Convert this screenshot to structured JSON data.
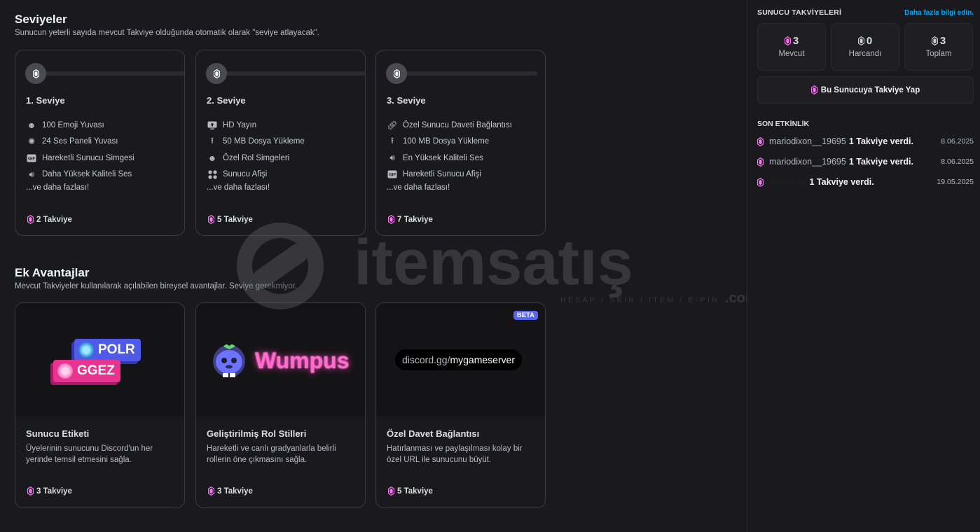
{
  "levels": {
    "title": "Seviyeler",
    "subtitle": "Sunucun yeterli sayıda mevcut Takviye olduğunda otomatik olarak \"seviye atlayacak\".",
    "tiers": [
      {
        "name": "1. Seviye",
        "perks": [
          {
            "icon": "emoji-icon",
            "label": "100 Emoji Yuvası"
          },
          {
            "icon": "soundboard-icon",
            "label": "24 Ses Paneli Yuvası"
          },
          {
            "icon": "gif-icon",
            "label": "Hareketli Sunucu Simgesi"
          },
          {
            "icon": "speaker-icon",
            "label": "Daha Yüksek Kaliteli Ses"
          }
        ],
        "more": "...ve daha fazlası!",
        "cost": "2 Takviye"
      },
      {
        "name": "2. Seviye",
        "perks": [
          {
            "icon": "screen-share-icon",
            "label": "HD Yayın"
          },
          {
            "icon": "upload-icon",
            "label": "50 MB Dosya Yükleme"
          },
          {
            "icon": "emoji-icon",
            "label": "Özel Rol Simgeleri"
          },
          {
            "icon": "grid-icon",
            "label": "Sunucu Afişi"
          }
        ],
        "more": "...ve daha fazlası!",
        "cost": "5 Takviye"
      },
      {
        "name": "3. Seviye",
        "perks": [
          {
            "icon": "link-icon",
            "label": "Özel Sunucu Daveti Bağlantısı"
          },
          {
            "icon": "upload-icon",
            "label": "100 MB Dosya Yükleme"
          },
          {
            "icon": "speaker-icon",
            "label": "En Yüksek Kaliteli Ses"
          },
          {
            "icon": "gif-icon",
            "label": "Hareketli Sunucu Afişi"
          }
        ],
        "more": "...ve daha fazlası!",
        "cost": "7 Takviye"
      }
    ]
  },
  "extras": {
    "title": "Ek Avantajlar",
    "subtitle": "Mevcut Takviyeler kullanılarak açılabilen bireysel avantajlar. Seviye gerekmiyor.",
    "perks": [
      {
        "title": "Sunucu Etiketi",
        "desc": "Üyelerinin sunucunu Discord'un her yerinde temsil etmesini sağla.",
        "cost": "3 Takviye",
        "art": {
          "tag1": "POLR",
          "tag2": "GGEZ"
        }
      },
      {
        "title": "Geliştirilmiş Rol Stilleri",
        "desc": "Hareketli ve canlı gradyanlarla belirli rollerin öne çıkmasını sağla.",
        "cost": "3 Takviye",
        "art": {
          "text": "Wumpus"
        }
      },
      {
        "title": "Özel Davet Bağlantısı",
        "desc": "Hatırlanması ve paylaşılması kolay bir özel URL ile sunucunu büyüt.",
        "cost": "5 Takviye",
        "badge": "BETA",
        "art": {
          "domain": "discord.gg/",
          "path": "mygameserver"
        }
      }
    ]
  },
  "sidebar": {
    "title": "SUNUCU TAKVİYELERİ",
    "link": "Daha fazla bilgi edin.",
    "stats": [
      {
        "value": "3",
        "label": "Mevcut"
      },
      {
        "value": "0",
        "label": "Harcandı"
      },
      {
        "value": "3",
        "label": "Toplam"
      }
    ],
    "boost_button": "Bu Sunucuya Takviye Yap",
    "activity_title": "SON ETKİNLİK",
    "activity": [
      {
        "user": "mariodixon__19695",
        "action": "1 Takviye verdi.",
        "date": "8.06.2025"
      },
      {
        "user": "mariodixon__19695",
        "action": "1 Takviye verdi.",
        "date": "8.06.2025"
      },
      {
        "user": "mekuszm",
        "action": "1 Takviye verdi.",
        "date": "19.05.2025"
      }
    ]
  },
  "watermark": {
    "brand": "itemsatış",
    "tagline": "HESAP / SKIN / ITEM / E-PIN",
    "suffix": ".com"
  },
  "colors": {
    "boost_pink": "#ff73fa",
    "accent_blue": "#00a8fc",
    "beta": "#5865f2"
  }
}
